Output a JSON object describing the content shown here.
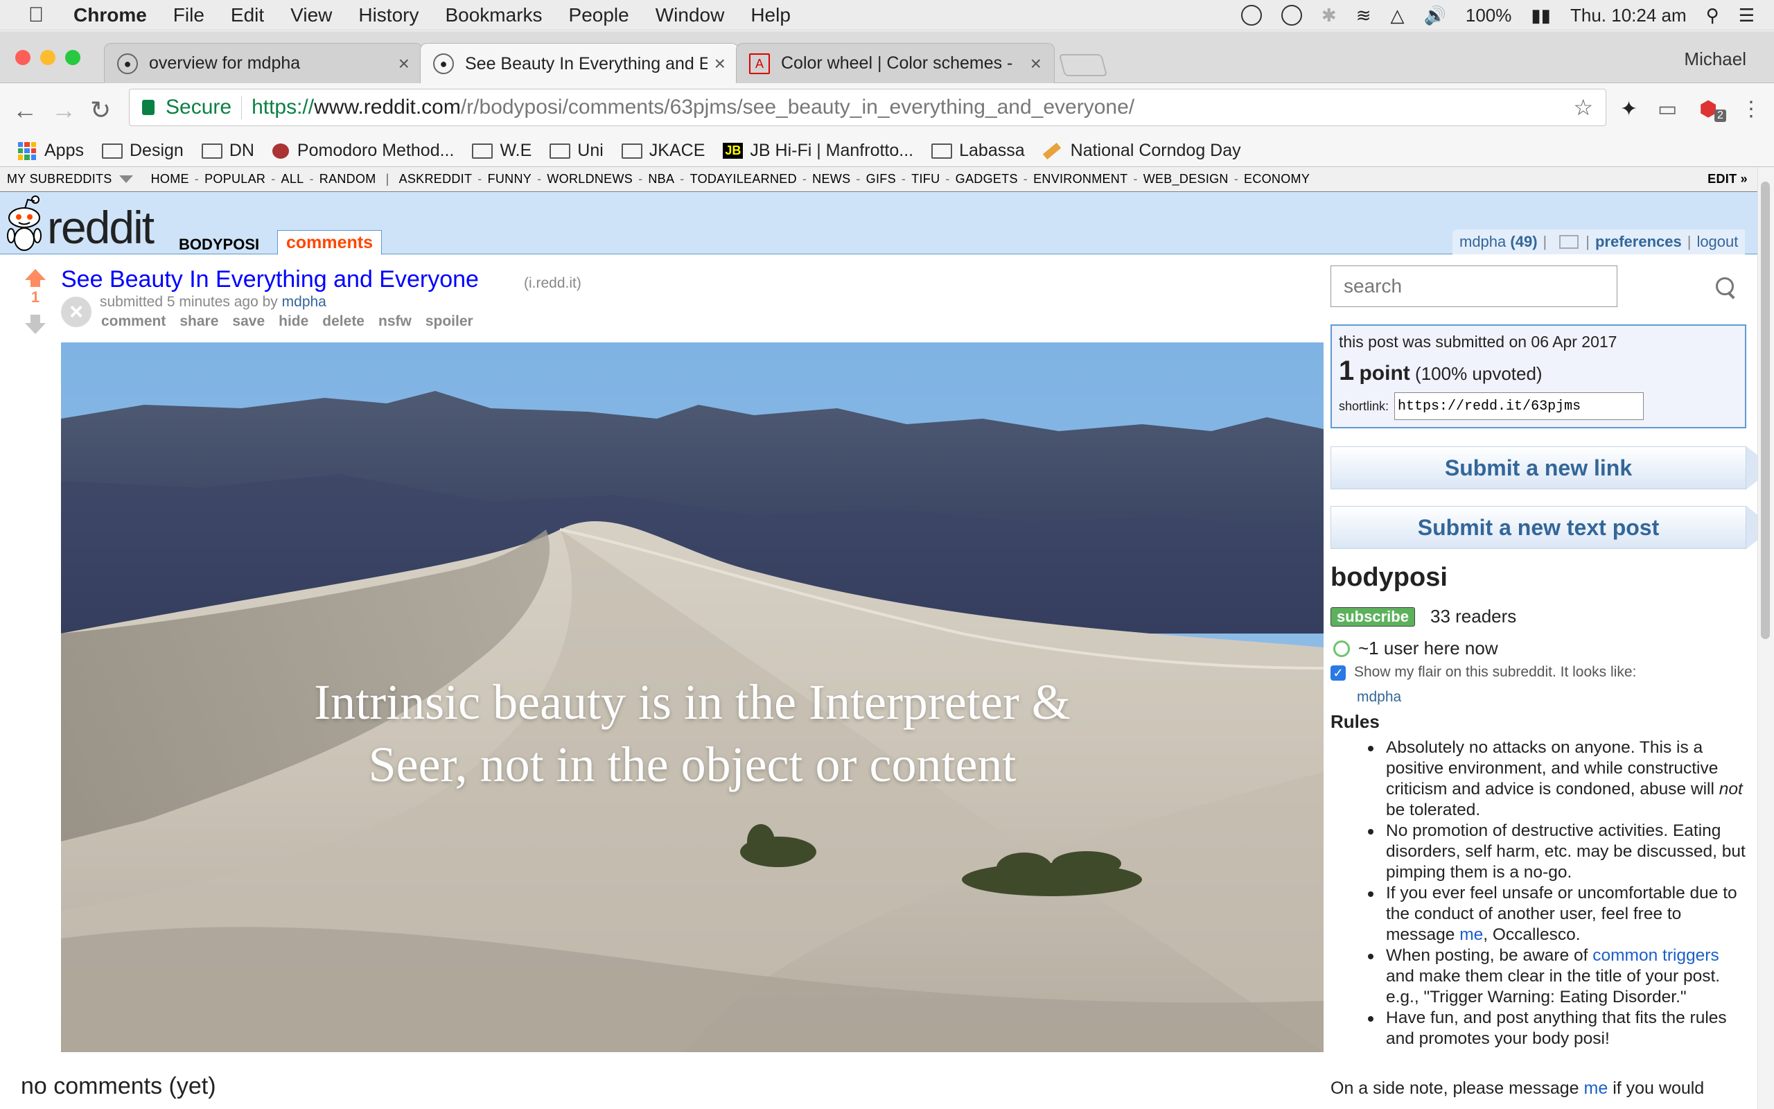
{
  "menubar": {
    "app": "Chrome",
    "items": [
      "File",
      "Edit",
      "View",
      "History",
      "Bookmarks",
      "People",
      "Window",
      "Help"
    ],
    "battery": "100%",
    "clock": "Thu. 10:24 am"
  },
  "tabs": [
    {
      "title": "overview for mdpha",
      "close": "×"
    },
    {
      "title": "See Beauty In Everything and E",
      "close": "×"
    },
    {
      "title": "Color wheel | Color schemes -",
      "close": "×"
    }
  ],
  "profile": "Michael",
  "omnibox": {
    "secure_label": "Secure",
    "scheme": "https://",
    "host": "www.reddit.com",
    "path": "/r/bodyposi/comments/63pjms/see_beauty_in_everything_and_everyone/"
  },
  "extension_badge": "2",
  "bookmarks": [
    {
      "label": "Apps",
      "icon": "apps-grid-icon"
    },
    {
      "label": "Design",
      "icon": "folder-icon"
    },
    {
      "label": "DN",
      "icon": "folder-icon"
    },
    {
      "label": "Pomodoro Method...",
      "icon": "pomodoro-icon"
    },
    {
      "label": "W.E",
      "icon": "folder-icon"
    },
    {
      "label": "Uni",
      "icon": "folder-icon"
    },
    {
      "label": "JKACE",
      "icon": "folder-icon"
    },
    {
      "label": "JB Hi-Fi | Manfrotto...",
      "icon": "jb-icon"
    },
    {
      "label": "Labassa",
      "icon": "folder-icon"
    },
    {
      "label": "National Corndog Day",
      "icon": "pencil-icon"
    }
  ],
  "srbar": {
    "my_subreddits": "MY SUBREDDITS",
    "main": [
      "HOME",
      "POPULAR",
      "ALL",
      "RANDOM"
    ],
    "subs": [
      "ASKREDDIT",
      "FUNNY",
      "WORLDNEWS",
      "NBA",
      "TODAYILEARNED",
      "NEWS",
      "GIFS",
      "TIFU",
      "GADGETS",
      "ENVIRONMENT",
      "WEB_DESIGN",
      "ECONOMY"
    ],
    "edit": "EDIT »"
  },
  "header": {
    "wordmark": "reddit",
    "pagename": "BODYPOSI",
    "active_tab": "comments",
    "user": "mdpha",
    "karma": "(49)",
    "preferences": "preferences",
    "logout": "logout"
  },
  "post": {
    "score": "1",
    "title": "See Beauty In Everything and Everyone",
    "domain": "(i.redd.it)",
    "submitted": "submitted 5 minutes ago by",
    "author": "mdpha",
    "buttons": [
      "comment",
      "share",
      "save",
      "hide",
      "delete",
      "nsfw",
      "spoiler"
    ],
    "caption_line1": "Intrinsic beauty is in the Interpreter &",
    "caption_line2": "Seer, not in the object or content"
  },
  "comments_status": "no comments (yet)",
  "sidebar": {
    "search_placeholder": "search",
    "submitted_on": "this post was submitted on 06 Apr 2017",
    "points": "1",
    "points_word": "point",
    "upvoted": "(100% upvoted)",
    "shortlink_label": "shortlink:",
    "shortlink": "https://redd.it/63pjms",
    "submit_link": "Submit a new link",
    "submit_text": "Submit a new text post",
    "subreddit": "bodyposi",
    "subscribe": "subscribe",
    "readers": "33 readers",
    "online": "~1 user here now",
    "flair_text": "Show my flair on this subreddit. It looks like:",
    "flair_name": "mdpha",
    "rules_heading": "Rules",
    "rules": [
      {
        "pre": "Absolutely no attacks on anyone. This is a positive environment, and while constructive criticism and advice is condoned, abuse will ",
        "em": "not",
        "post": " be tolerated."
      },
      {
        "pre": "No promotion of destructive activities. Eating disorders, self harm, etc. may be discussed, but pimping them is a no-go."
      },
      {
        "pre": "If you ever feel unsafe or uncomfortable due to the conduct of another user, feel free to message ",
        "link": "me",
        "post": ", Occallesco."
      },
      {
        "pre": "When posting, be aware of ",
        "link": "common triggers",
        "post": " and make them clear in the title of your post. e.g., \"Trigger Warning: Eating Disorder.\""
      },
      {
        "pre": "Have fun, and post anything that fits the rules and promotes your body posi!"
      }
    ],
    "sidenote_pre": "On a side note, please message ",
    "sidenote_link": "me",
    "sidenote_post": " if you would"
  }
}
